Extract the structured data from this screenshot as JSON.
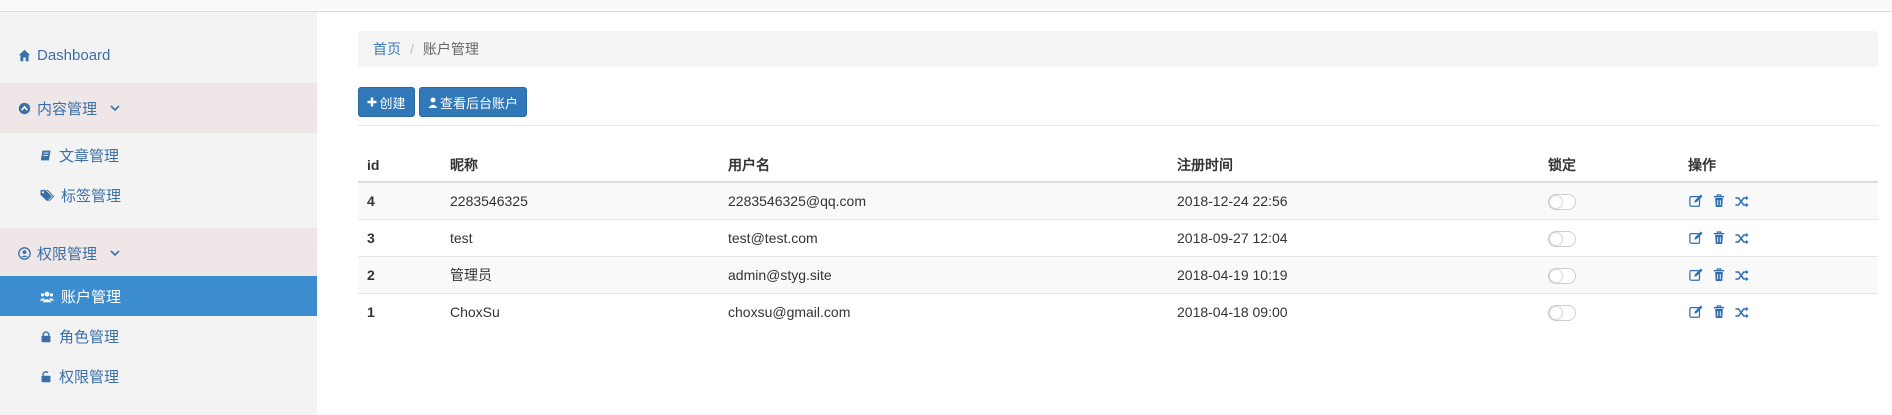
{
  "sidebar": {
    "dashboard": "Dashboard",
    "content_mgmt": "内容管理",
    "article_mgmt": "文章管理",
    "tag_mgmt": "标签管理",
    "perm_mgmt_section": "权限管理",
    "account_mgmt": "账户管理",
    "role_mgmt": "角色管理",
    "perm_mgmt": "权限管理"
  },
  "breadcrumb": {
    "home": "首页",
    "separator": "/",
    "current": "账户管理"
  },
  "toolbar": {
    "create_label": "创建",
    "view_admin_label": "查看后台账户"
  },
  "table": {
    "headers": {
      "id": "id",
      "nickname": "昵称",
      "username": "用户名",
      "registered": "注册时间",
      "locked": "锁定",
      "actions": "操作"
    },
    "rows": [
      {
        "id": "4",
        "nickname": "2283546325",
        "username": "2283546325@qq.com",
        "registered": "2018-12-24 22:56",
        "locked": false
      },
      {
        "id": "3",
        "nickname": "test",
        "username": "test@test.com",
        "registered": "2018-09-27 12:04",
        "locked": false
      },
      {
        "id": "2",
        "nickname": "管理员",
        "username": "admin@styg.site",
        "registered": "2018-04-19 10:19",
        "locked": false
      },
      {
        "id": "1",
        "nickname": "ChoxSu",
        "username": "choxsu@gmail.com",
        "registered": "2018-04-18 09:00",
        "locked": false
      }
    ]
  },
  "icons": {
    "dashboard": "home-icon",
    "content": "circle-up-icon",
    "article": "book-icon",
    "tag": "tags-icon",
    "perm_section": "user-circle-icon",
    "account": "users-icon",
    "role": "lock-icon",
    "perm": "unlock-icon",
    "edit": "edit-icon",
    "delete": "trash-icon",
    "shuffle": "shuffle-icon"
  },
  "colors": {
    "accent": "#3c8dd0",
    "button": "#3178b8",
    "link": "#3a6fa8"
  }
}
